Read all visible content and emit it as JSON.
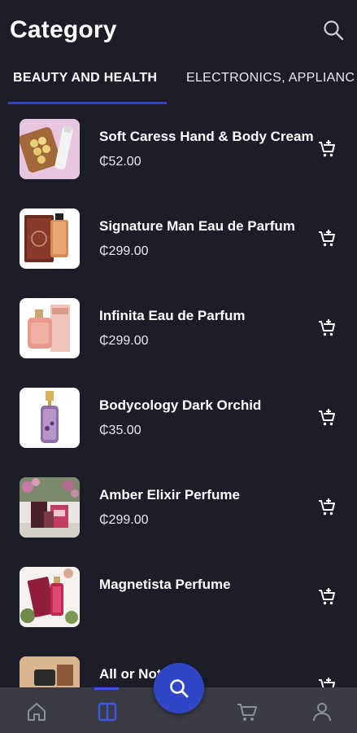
{
  "header": {
    "title": "Category",
    "search_icon": "search-icon"
  },
  "tabs": [
    {
      "label": "BEAUTY AND HEALTH",
      "active": true
    },
    {
      "label": "ELECTRONICS, APPLIANC"
    }
  ],
  "products": [
    {
      "name": "Soft Caress Hand & Body Cream",
      "price": "₵52.00"
    },
    {
      "name": "Signature Man Eau de Parfum",
      "price": "₵299.00"
    },
    {
      "name": "Infinita Eau de Parfum",
      "price": "₵299.00"
    },
    {
      "name": "Bodycology Dark Orchid",
      "price": "₵35.00"
    },
    {
      "name": "Amber Elixir Perfume",
      "price": "₵299.00"
    },
    {
      "name": "Magnetista Perfume",
      "price": ""
    },
    {
      "name": "All or Not",
      "price": ""
    }
  ],
  "bottom_nav": {
    "items": [
      "home-icon",
      "category-icon",
      "search-icon",
      "cart-icon",
      "profile-icon"
    ],
    "active": "category-icon"
  },
  "colors": {
    "background": "#1c1d27",
    "accent": "#2f46c7",
    "nav": "#3a3b44"
  }
}
